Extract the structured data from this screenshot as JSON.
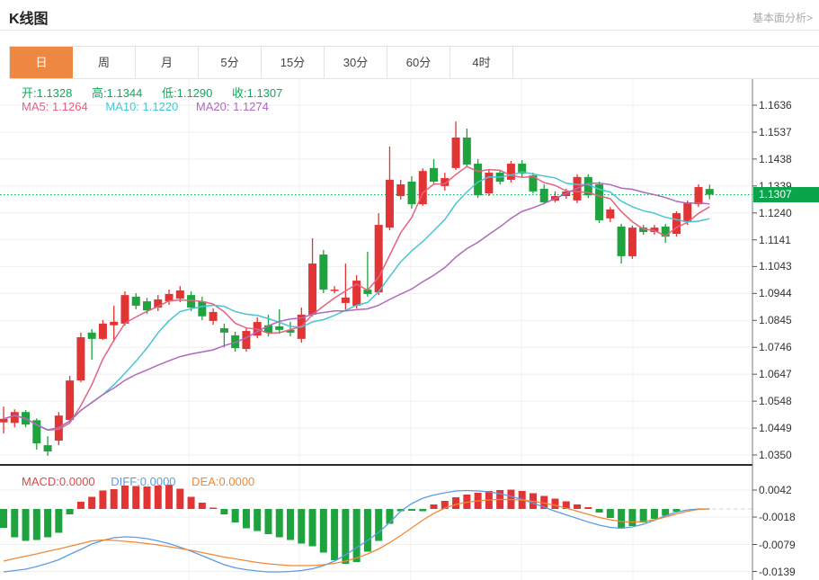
{
  "header": {
    "title": "K线图",
    "link": "基本面分析>"
  },
  "tabs": {
    "items": [
      "日",
      "周",
      "月",
      "5分",
      "15分",
      "30分",
      "60分",
      "4时"
    ],
    "active_index": 0
  },
  "quote": {
    "open": "开:1.1328",
    "high": "高:1.1344",
    "low": "低:1.1290",
    "close": "收:1.1307"
  },
  "ma_legend": {
    "ma5": "MA5: 1.1264",
    "ma10": "MA10: 1.1220",
    "ma20": "MA20: 1.1274"
  },
  "macd_legend": {
    "macd": "MACD:0.0000",
    "diff": "DIFF:0.0000",
    "dea": "DEA:0.0000"
  },
  "axis": {
    "price_ticks": [
      "1.1636",
      "1.1537",
      "1.1438",
      "1.1339",
      "1.1240",
      "1.1141",
      "1.1043",
      "1.0944",
      "1.0845",
      "1.0746",
      "1.0647",
      "1.0548",
      "1.0449",
      "1.0350"
    ],
    "macd_ticks": [
      "0.0042",
      "-0.0018",
      "-0.0079",
      "-0.0139"
    ],
    "current_price": "1.1307"
  },
  "colors": {
    "up": "#e13434",
    "down": "#1ea33f",
    "ma5": "#e5637f",
    "ma10": "#49c4d6",
    "ma20": "#b168be",
    "diff": "#5b9ce6",
    "dea": "#f08937",
    "macd_label": "#e04848",
    "ohlc_text": "#14a85c",
    "price_line": "#16a85a",
    "tag_bg": "#0aa44a",
    "tab_active": "#ee8742"
  },
  "chart_data": {
    "type": "candlestick_with_macd",
    "title": "K线图",
    "price_axis_range": [
      1.035,
      1.1636
    ],
    "macd_axis_range": [
      -0.0139,
      0.0042
    ],
    "ma_periods": [
      5,
      10,
      20
    ],
    "candles": [
      [
        1.047,
        1.0528,
        1.0429,
        1.0483
      ],
      [
        1.0468,
        1.0518,
        1.0452,
        1.0508
      ],
      [
        1.0508,
        1.0515,
        1.0452,
        1.0462
      ],
      [
        1.0478,
        1.0485,
        1.037,
        1.0393
      ],
      [
        1.0386,
        1.0419,
        1.0347,
        1.0363
      ],
      [
        1.0403,
        1.0508,
        1.0386,
        1.0495
      ],
      [
        1.0479,
        1.0641,
        1.0469,
        1.0624
      ],
      [
        1.0624,
        1.08,
        1.0618,
        1.0783
      ],
      [
        1.08,
        1.0813,
        1.07,
        1.0777
      ],
      [
        1.0777,
        1.0846,
        1.0773,
        1.0833
      ],
      [
        1.0827,
        1.0899,
        1.0766,
        1.084
      ],
      [
        1.0833,
        1.0952,
        1.0826,
        1.0938
      ],
      [
        1.0932,
        1.0945,
        1.0886,
        1.0899
      ],
      [
        1.0915,
        1.0928,
        1.0869,
        1.0882
      ],
      [
        1.0892,
        1.0938,
        1.0879,
        1.0922
      ],
      [
        1.0915,
        1.0958,
        1.0902,
        1.0942
      ],
      [
        1.0925,
        1.0971,
        1.0912,
        1.0955
      ],
      [
        1.0938,
        1.0952,
        1.0879,
        1.0892
      ],
      [
        1.0915,
        1.0932,
        1.0846,
        1.086
      ],
      [
        1.0843,
        1.0889,
        1.0829,
        1.0876
      ],
      [
        1.0816,
        1.0833,
        1.0746,
        1.08
      ],
      [
        1.079,
        1.0803,
        1.073,
        1.0743
      ],
      [
        1.074,
        1.0819,
        1.073,
        1.0806
      ],
      [
        1.0789,
        1.0856,
        1.0779,
        1.0839
      ],
      [
        1.0827,
        1.0866,
        1.0786,
        1.08
      ],
      [
        1.0823,
        1.0886,
        1.0796,
        1.081
      ],
      [
        1.081,
        1.084,
        1.0786,
        1.08
      ],
      [
        1.0777,
        1.0892,
        1.0763,
        1.0866
      ],
      [
        1.0866,
        1.1147,
        1.086,
        1.1054
      ],
      [
        1.1087,
        1.1104,
        1.0945,
        1.0958
      ],
      [
        1.0955,
        1.0971,
        1.0945,
        1.0958
      ],
      [
        1.0909,
        1.1054,
        1.0879,
        1.0929
      ],
      [
        1.0899,
        1.1011,
        1.0889,
        1.0991
      ],
      [
        1.0958,
        1.1097,
        1.0932,
        1.0942
      ],
      [
        1.0948,
        1.1239,
        1.0938,
        1.1196
      ],
      [
        1.1186,
        1.1484,
        1.1176,
        1.1362
      ],
      [
        1.1302,
        1.1362,
        1.1289,
        1.1345
      ],
      [
        1.1355,
        1.1375,
        1.1256,
        1.1272
      ],
      [
        1.1272,
        1.1404,
        1.1266,
        1.1394
      ],
      [
        1.1405,
        1.1438,
        1.1345,
        1.1355
      ],
      [
        1.1339,
        1.1388,
        1.1322,
        1.1368
      ],
      [
        1.1405,
        1.1576,
        1.1398,
        1.1517
      ],
      [
        1.1517,
        1.155,
        1.1408,
        1.1418
      ],
      [
        1.1421,
        1.1438,
        1.1295,
        1.1305
      ],
      [
        1.1312,
        1.1398,
        1.1302,
        1.1388
      ],
      [
        1.1388,
        1.1398,
        1.1345,
        1.1355
      ],
      [
        1.1362,
        1.1431,
        1.1352,
        1.1421
      ],
      [
        1.1421,
        1.1434,
        1.1372,
        1.1385
      ],
      [
        1.1378,
        1.1388,
        1.1312,
        1.1319
      ],
      [
        1.1329,
        1.1345,
        1.1272,
        1.1279
      ],
      [
        1.1285,
        1.1319,
        1.1279,
        1.1302
      ],
      [
        1.1302,
        1.1329,
        1.1292,
        1.1319
      ],
      [
        1.1286,
        1.1382,
        1.1276,
        1.1372
      ],
      [
        1.1372,
        1.1382,
        1.1295,
        1.1305
      ],
      [
        1.1345,
        1.1355,
        1.1203,
        1.1213
      ],
      [
        1.122,
        1.1262,
        1.1206,
        1.1253
      ],
      [
        1.119,
        1.12,
        1.1054,
        1.1081
      ],
      [
        1.1081,
        1.1193,
        1.1071,
        1.1186
      ],
      [
        1.1186,
        1.1196,
        1.116,
        1.117
      ],
      [
        1.117,
        1.1196,
        1.116,
        1.1186
      ],
      [
        1.119,
        1.12,
        1.113,
        1.1153
      ],
      [
        1.1163,
        1.1246,
        1.1153,
        1.1239
      ],
      [
        1.1206,
        1.1286,
        1.1196,
        1.1279
      ],
      [
        1.1272,
        1.1345,
        1.1262,
        1.1335
      ],
      [
        1.1328,
        1.1344,
        1.129,
        1.1307
      ]
    ],
    "macd": {
      "histogram": [
        -0.0042,
        -0.0063,
        -0.0071,
        -0.0069,
        -0.0063,
        -0.0053,
        -0.0012,
        0.0016,
        0.0027,
        0.0041,
        0.0044,
        0.0052,
        0.0051,
        0.005,
        0.0052,
        0.0054,
        0.0045,
        0.0027,
        0.0014,
        0.0003,
        -0.0012,
        -0.003,
        -0.0043,
        -0.0049,
        -0.0056,
        -0.0063,
        -0.0069,
        -0.0077,
        -0.0083,
        -0.0097,
        -0.0114,
        -0.0122,
        -0.0118,
        -0.0095,
        -0.0071,
        -0.0033,
        -0.0005,
        -0.0004,
        -0.0005,
        0.001,
        0.0018,
        0.0026,
        0.0032,
        0.0036,
        0.004,
        0.0042,
        0.0043,
        0.004,
        0.0035,
        0.0029,
        0.0023,
        0.0017,
        0.001,
        0.0004,
        -0.0008,
        -0.002,
        -0.0043,
        -0.0038,
        -0.003,
        -0.0022,
        -0.0015,
        -0.0006,
        0.0,
        0.0,
        0.0
      ],
      "diff": [
        -0.014,
        -0.0137,
        -0.0134,
        -0.0128,
        -0.0121,
        -0.0113,
        -0.0101,
        -0.009,
        -0.0078,
        -0.007,
        -0.0064,
        -0.0062,
        -0.0063,
        -0.0066,
        -0.0071,
        -0.0077,
        -0.0085,
        -0.0094,
        -0.0104,
        -0.0114,
        -0.0124,
        -0.0131,
        -0.0135,
        -0.0138,
        -0.014,
        -0.014,
        -0.0139,
        -0.0137,
        -0.0133,
        -0.0126,
        -0.0116,
        -0.0102,
        -0.0086,
        -0.007,
        -0.0052,
        -0.003,
        -0.0005,
        0.0012,
        0.0024,
        0.0031,
        0.0036,
        0.004,
        0.0041,
        0.004,
        0.0038,
        0.0034,
        0.0028,
        0.0021,
        0.0013,
        0.0004,
        -0.0005,
        -0.0013,
        -0.0021,
        -0.0029,
        -0.0036,
        -0.0041,
        -0.0043,
        -0.004,
        -0.0034,
        -0.0025,
        -0.0015,
        -0.0007,
        -0.0002,
        0.0,
        0.0
      ],
      "dea": [
        -0.0116,
        -0.011,
        -0.0105,
        -0.01,
        -0.0094,
        -0.0089,
        -0.0083,
        -0.0077,
        -0.0071,
        -0.0069,
        -0.007,
        -0.0072,
        -0.0074,
        -0.0077,
        -0.008,
        -0.0084,
        -0.0088,
        -0.0092,
        -0.0097,
        -0.0102,
        -0.0107,
        -0.0111,
        -0.0115,
        -0.0119,
        -0.0122,
        -0.0124,
        -0.0126,
        -0.0126,
        -0.0126,
        -0.0124,
        -0.0121,
        -0.0116,
        -0.0109,
        -0.01,
        -0.0089,
        -0.0075,
        -0.0059,
        -0.0042,
        -0.0025,
        -0.001,
        0.0002,
        0.001,
        0.0015,
        0.0018,
        0.002,
        0.0021,
        0.0021,
        0.002,
        0.0017,
        0.0013,
        0.0008,
        0.0002,
        -0.0005,
        -0.0012,
        -0.0019,
        -0.0024,
        -0.0028,
        -0.0029,
        -0.0028,
        -0.0024,
        -0.0018,
        -0.0011,
        -0.0005,
        -0.0001,
        0.0
      ]
    }
  }
}
